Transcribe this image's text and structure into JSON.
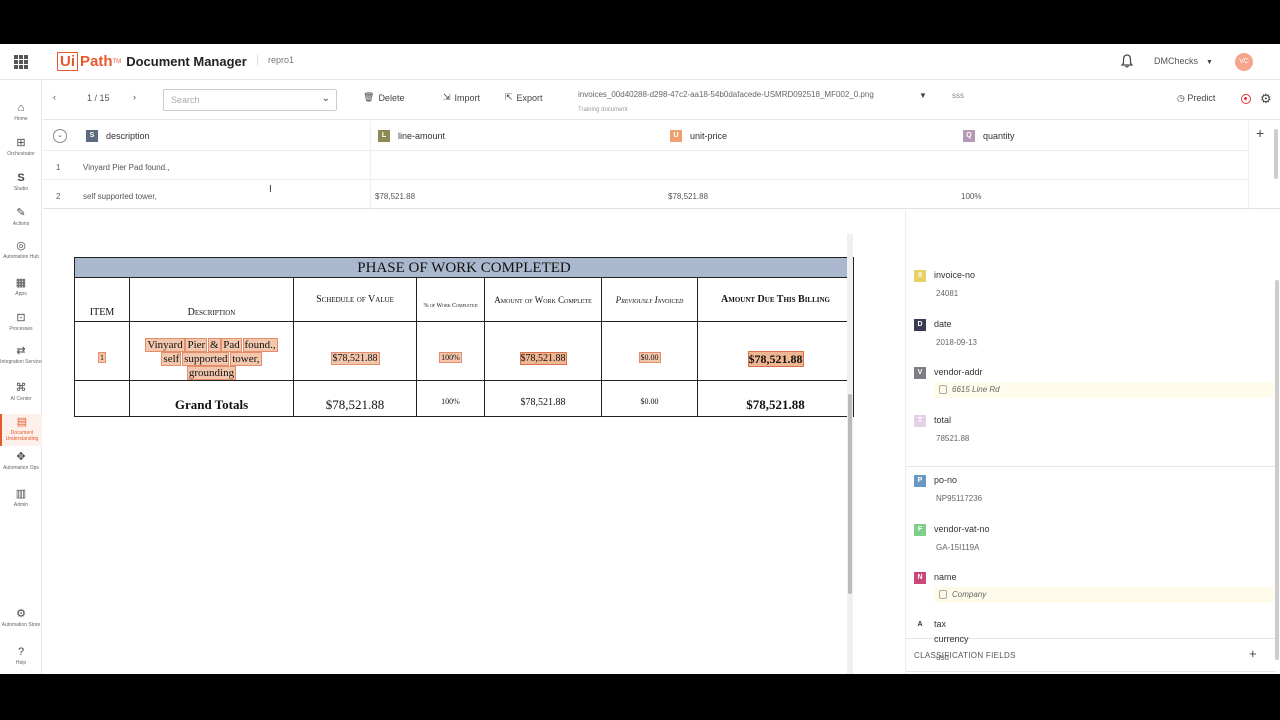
{
  "header": {
    "logo_box": "Ui",
    "logo_path": "Path",
    "logo_tm": "TM",
    "app_title": "Document Manager",
    "tenant": "repro1",
    "user": "DMChecks",
    "avatar_initials": "VC"
  },
  "nav": [
    {
      "label": "Home",
      "icon": "home-icon"
    },
    {
      "label": "Orchestrator",
      "icon": "orchestrator-icon"
    },
    {
      "label": "Studio",
      "icon": "studio-icon"
    },
    {
      "label": "Actions",
      "icon": "actions-icon"
    },
    {
      "label": "Automation Hub",
      "icon": "automation-hub-icon"
    },
    {
      "label": "Apps",
      "icon": "apps-icon"
    },
    {
      "label": "Processes",
      "icon": "processes-icon"
    },
    {
      "label": "Integration Service",
      "icon": "integration-icon"
    },
    {
      "label": "AI Center",
      "icon": "ai-center-icon"
    },
    {
      "label": "Document Understanding",
      "icon": "document-icon"
    },
    {
      "label": "Automation Ops",
      "icon": "automation-ops-icon"
    },
    {
      "label": "Admin",
      "icon": "admin-icon"
    },
    {
      "label": "Automation Store",
      "icon": "store-icon"
    },
    {
      "label": "Help",
      "icon": "help-icon"
    }
  ],
  "toolbar": {
    "pager": "1 / 15",
    "search_placeholder": "Search",
    "delete": "Delete",
    "import": "Import",
    "export": "Export",
    "doc_name": "invoices_00d40288-d298-47c2-aa18-54b0dafacede-USMRD092518_MF002_0.png",
    "doc_sub": "Training document",
    "doc_ext": "sss",
    "predict": "Predict"
  },
  "table": {
    "columns": [
      {
        "tag": "S",
        "color": "#5d6b7d",
        "name": "description"
      },
      {
        "tag": "L",
        "color": "#8a8a55",
        "name": "line-amount"
      },
      {
        "tag": "U",
        "color": "#f0a070",
        "name": "unit-price"
      },
      {
        "tag": "Q",
        "color": "#b49ab4",
        "name": "quantity"
      }
    ],
    "rows": [
      {
        "num": "1",
        "description": "Vinyard Pier Pad found.,",
        "line_amount": "",
        "unit_price": "",
        "quantity": ""
      },
      {
        "num": "2",
        "description": "self supported tower,",
        "line_amount": "$78,521.88",
        "unit_price": "$78,521.88",
        "quantity": "100%"
      }
    ]
  },
  "document": {
    "title": "PHASE OF WORK COMPLETED",
    "headers": {
      "item": "ITEM",
      "description": "Description",
      "schedule": "Schedule of Value",
      "pct": "% of Work Completed",
      "amount_work": "Amount of Work Complete",
      "prev": "Previously Invoiced",
      "amount_due": "Amount Due This Billing"
    },
    "row": {
      "item": "1",
      "desc_line1_a": "Vinyard",
      "desc_line1_b": "Pier",
      "desc_line1_c": "&",
      "desc_line1_d": "Pad",
      "desc_line1_e": "found.,",
      "desc_line2_a": "self",
      "desc_line2_b": "supported",
      "desc_line2_c": "tower,",
      "desc_line3": "grounding",
      "schedule": "$78,521.88",
      "pct": "100%",
      "amount_work": "$78,521.88",
      "prev": "$0.00",
      "amount_due": "$78,521.88"
    },
    "totals": {
      "label": "Grand Totals",
      "schedule": "$78,521.88",
      "pct": "100%",
      "amount_work": "$78,521.88",
      "prev": "$0.00",
      "amount_due": "$78,521.88"
    }
  },
  "fields": [
    {
      "tag": "II",
      "color": "#e8d26a",
      "name": "invoice-no",
      "value": "24081",
      "suggested": false
    },
    {
      "tag": "D",
      "color": "#3a3a55",
      "name": "date",
      "value": "2018-09-13",
      "suggested": false
    },
    {
      "tag": "V",
      "color": "#7d7d85",
      "name": "vendor-addr",
      "value": "6615 Line Rd",
      "suggested": true
    },
    {
      "tag": "T",
      "color": "#e6cfe8",
      "name": "total",
      "value": "78521.88",
      "suggested": false
    },
    {
      "tag": "P",
      "color": "#6a9ac4",
      "name": "po-no",
      "value": "NP95117236",
      "suggested": false
    },
    {
      "tag": "F",
      "color": "#7fcf8a",
      "name": "vendor-vat-no",
      "value": "GA-15I119A",
      "suggested": false
    },
    {
      "tag": "N",
      "color": "#c8487a",
      "name": "name",
      "value": "Company",
      "suggested": true
    },
    {
      "tag": "A",
      "color": "#ffffff",
      "name": "tax",
      "value": "",
      "suggested": false
    }
  ],
  "classification": {
    "heading": "CLASSIFICATION FIELDS",
    "field_name": "currency",
    "field_value": "usd"
  }
}
